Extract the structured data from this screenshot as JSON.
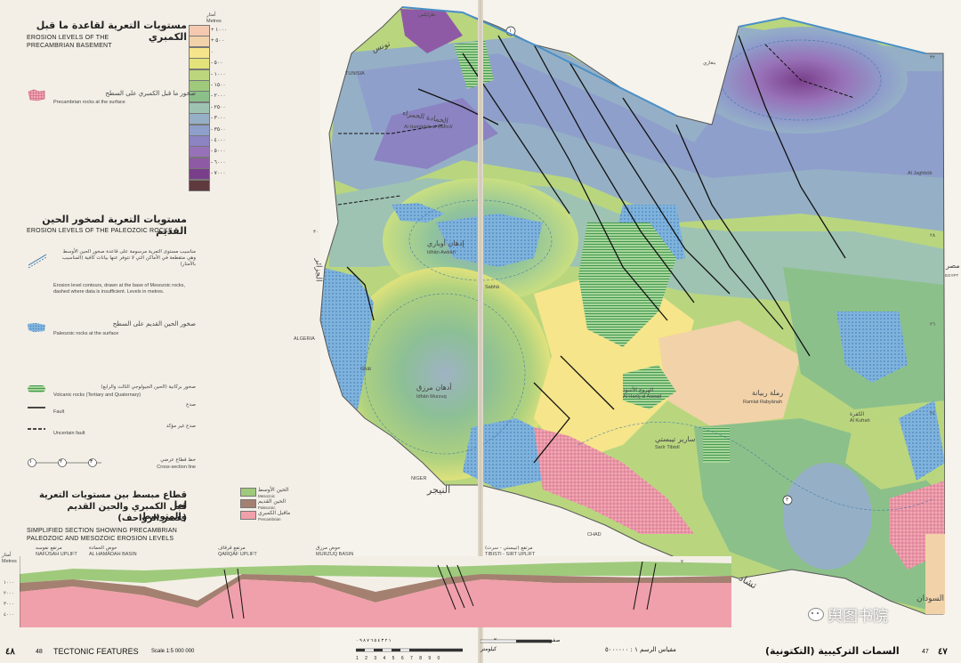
{
  "legend": {
    "precambrian_title_ar": "مستويات التعرية لقاعدة ما قبل الكمبري",
    "precambrian_title_en_1": "EROSION LEVELS OF THE",
    "precambrian_title_en_2": "PRECAMBRIAN BASEMENT",
    "scale_header_ar": "أمتار",
    "scale_header_en": "Metres",
    "scale": [
      {
        "label": "+ ١٠٠٠",
        "color": "#f5c9b0"
      },
      {
        "label": "+ ٥٠٠",
        "color": "#f2d2a8"
      },
      {
        "label": "٠",
        "color": "#f6e58a"
      },
      {
        "label": "- ٥٠٠",
        "color": "#e3e27a"
      },
      {
        "label": "- ١٠٠٠",
        "color": "#bcd67e"
      },
      {
        "label": "- ١٥٠٠",
        "color": "#9fca7c"
      },
      {
        "label": "- ٢٠٠٠",
        "color": "#8cc08a"
      },
      {
        "label": "- ٢٥٠٠",
        "color": "#9ec3b3"
      },
      {
        "label": "- ٣٠٠٠",
        "color": "#95b0c6"
      },
      {
        "label": "- ٣٥٠٠",
        "color": "#8f9fcb"
      },
      {
        "label": "- ٤٠٠٠",
        "color": "#8c83c2"
      },
      {
        "label": "- ٥٠٠٠",
        "color": "#9872b8"
      },
      {
        "label": "- ٦٠٠٠",
        "color": "#8f5aa5"
      },
      {
        "label": "- ٧٠٠٠",
        "color": "#7a3f8a"
      },
      {
        "label": "",
        "color": "#5e3a3e"
      }
    ],
    "precambrian_surface_ar": "صخور ما قبل الكمبري على السطح",
    "precambrian_surface_en": "Precambrian rocks at the surface",
    "paleozoic_title_ar": "مستويات التعرية لصخور الحين القديم",
    "paleozoic_title_en": "EROSION LEVELS OF THE PALEOZOIC ROCKS",
    "contours_ar": "مناسيب مستوى التعرية مرسومة على قاعدة صخور الحين الأوسط وهي متقطعة في الأماكن التي لا تتوفر عنها بيانات كافية (المناسيب بالأمتار)",
    "contours_en": "Erosion level contours, drawn at the base of Mesozoic rocks, dashed where data is insufficient. Levels in metres.",
    "paleozoic_surface_ar": "صخور الحين القديم على السطح",
    "paleozoic_surface_en": "Paleozoic rocks at the surface",
    "volcanic_ar": "صخور بركانية (الحين الجيولوجي الثالث والرابع)",
    "volcanic_en": "Volcanic rocks (Tertiary and Quaternary)",
    "fault_ar": "صدع",
    "fault_en": "Fault",
    "uncertain_fault_ar": "صدع غير مؤكد",
    "uncertain_fault_en": "Uncertain fault",
    "section_line_ar": "خط قطاع عرضي",
    "section_line_en": "Cross-section line",
    "section_markers": [
      "١",
      "٢",
      "٣"
    ]
  },
  "section": {
    "title_ar_1": "قطاع مبسط بين مستويات التعرية لما",
    "title_ar_2": "قبل الكمبري والحين القديم والمتوسط",
    "title_ar_3": "(عصر الزواحف)",
    "title_en_1": "SIMPLIFIED SECTION SHOWING PRECAMBRIAN",
    "title_en_2": "PALEOZOIC AND MESOZOIC EROSION LEVELS",
    "key": [
      {
        "ar": "الحين الأوسط",
        "en": "Mesozoic",
        "color": "#9fca7c"
      },
      {
        "ar": "الحين القديم",
        "en": "Paleozoic",
        "color": "#a48070"
      },
      {
        "ar": "ماقبل الكمبري",
        "en": "Precambrian",
        "color": "#f0a0aa"
      }
    ],
    "axis_ar": "أمتار",
    "axis_en": "Metres",
    "ticks": [
      "١٠٠٠",
      "٢٠٠٠",
      "٣٠٠٠",
      "٤٠٠٠"
    ],
    "places": [
      {
        "ar": "مرتفع نفوسه",
        "en": "NAFŪSAH UPLIFT"
      },
      {
        "ar": "حوض الحمادة",
        "en": "AL ḤAMĀDAH BASIN"
      },
      {
        "ar": "مرتفع قرقاف",
        "en": "QARQĀF UPLIFT"
      },
      {
        "ar": "حوض مرزق",
        "en": "MURZUQ BASIN"
      },
      {
        "ar": "مرتفع (تيبستي - سرت)",
        "en": "TIBISTI - SIRT UPLIFT"
      }
    ]
  },
  "map_labels": {
    "tunisia_ar": "تونس",
    "tunisia_en": "TUNISIA",
    "algeria_ar": "الجزائر",
    "algeria_en": "ALGERIA",
    "niger_ar": "النيجر",
    "niger_en": "NIGER",
    "chad_ar": "تشاد",
    "chad_en": "CHAD",
    "egypt_ar": "مصر",
    "egypt_en": "EGYPT",
    "sudan_ar": "السودان",
    "hamadah_ar": "الحمادة الحمراء",
    "hamadah_en": "Al Ḥamādah al Ḥamrā'",
    "awbari_ar": "إدهان أوباري",
    "awbari_en": "Idhān Awbārī",
    "murzuq_ar": "أدهان مرزق",
    "murzuq_en": "Idhān Murzuq",
    "rabyanah_ar": "رملة ربيانة",
    "rabyanah_en": "Ramlat Rabyānah",
    "tibisti_ar": "سارير تيبستي",
    "tibisti_en": "Sarīr Tibistī",
    "harwaj_ar": "الهروج الأسود",
    "harwaj_en": "Al Harūj al Aswad",
    "kufrah_ar": "الكفرة",
    "kufrah_en": "Al Kufrah",
    "sabha_en": "Sabhā",
    "ghat_en": "Ghāt",
    "jaghbub_en": "Al Jaghbūb",
    "tarabulus_ar": "طرابلس",
    "benghazi_ar": "بنغازي",
    "lat_ticks": [
      "٣٢",
      "٢٨",
      "٢٦",
      "٢٤",
      "٣٠"
    ],
    "markers": [
      "١",
      "٢",
      "٣"
    ]
  },
  "footer": {
    "page_left_ar": "٤٨",
    "page_left": "48",
    "title_en": "TECTONIC FEATURES",
    "scale_en": "Scale 1:5 000 000",
    "scale_ar": "مقياس الرسم ١ : ٥٠٠٠٠٠٠",
    "km_ar": "كيلومتر",
    "km_zero_ar": "صفر",
    "km_200_ar": "٢٠٠",
    "scale_digits_ar": "١ ٢ ٣ ٤ ٥ ٦ ٧ ٨ ٩ ٠",
    "scale_digits": "1 2 3 4 5 6 7 8 9 0",
    "title_ar": "السمات التركيبية (التكتونية)",
    "page_right": "47",
    "page_right_ar": "٤٧"
  },
  "watermark": {
    "text": "舆图书院"
  }
}
